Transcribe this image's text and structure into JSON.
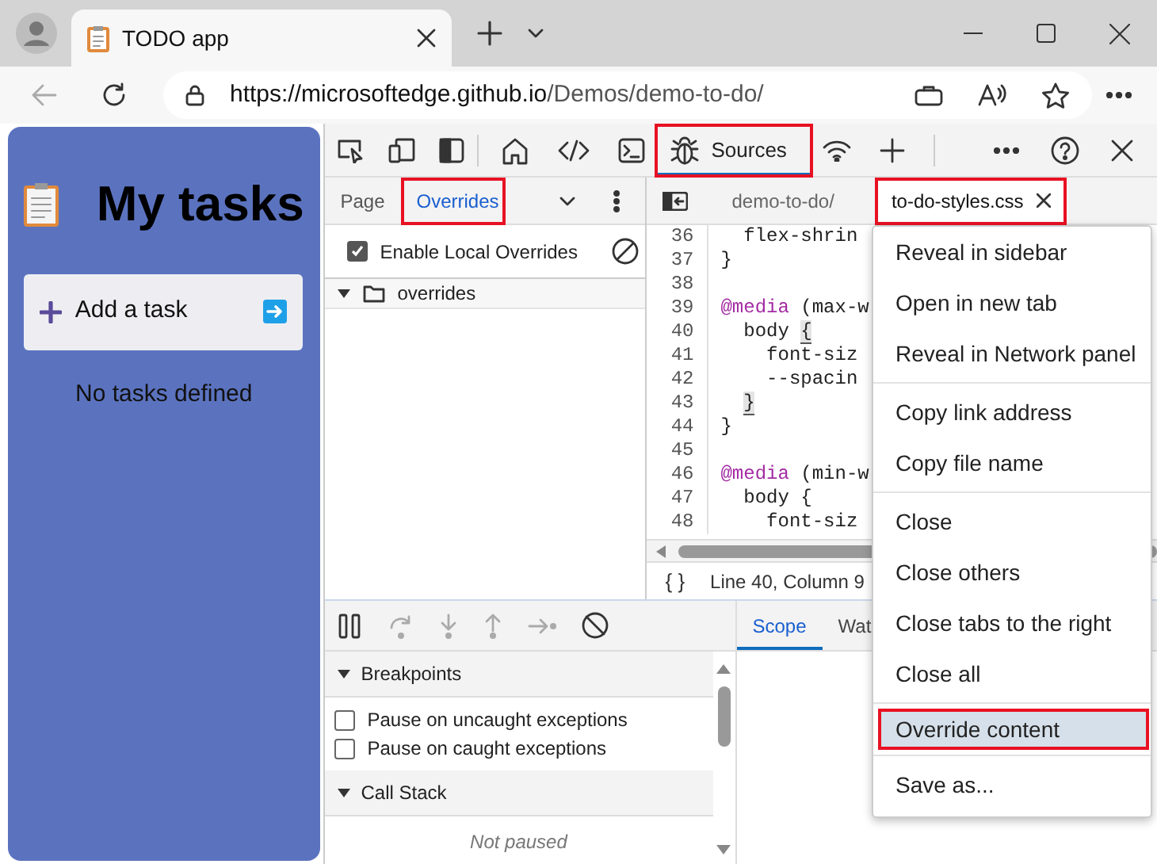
{
  "browser": {
    "tab": {
      "title": "TODO app",
      "selected": true
    },
    "url": {
      "host": "https://microsoftedge.github.io",
      "path": "/Demos/demo-to-do/"
    }
  },
  "app": {
    "title": "My tasks",
    "add_task": "Add a task",
    "empty_message": "No tasks defined"
  },
  "devtools": {
    "tool_tabs": [
      {
        "label": "Sources",
        "selected": true,
        "highlighted": true
      }
    ],
    "navigator": {
      "tabs": [
        {
          "label": "Page",
          "selected": false,
          "highlighted": false
        },
        {
          "label": "Overrides",
          "selected": true,
          "highlighted": true
        }
      ],
      "enable_overrides": {
        "label": "Enable Local Overrides",
        "checked": true
      },
      "tree": [
        {
          "label": "overrides",
          "expanded": true
        }
      ]
    },
    "editor": {
      "tabs": [
        {
          "label": "demo-to-do/",
          "selected": false,
          "highlighted": false,
          "closable": false
        },
        {
          "label": "to-do-styles.css",
          "selected": true,
          "highlighted": true,
          "closable": true
        }
      ],
      "lines": [
        {
          "number": "36",
          "segments": [
            {
              "kind": "plain",
              "text": "  flex-shrin"
            }
          ]
        },
        {
          "number": "37",
          "segments": [
            {
              "kind": "plain",
              "text": "}"
            }
          ]
        },
        {
          "number": "38"
        },
        {
          "number": "39",
          "segments": [
            {
              "kind": "keyword",
              "text": "@media"
            },
            {
              "kind": "plain",
              "text": " (max-w"
            }
          ]
        },
        {
          "number": "40",
          "segments": [
            {
              "kind": "plain",
              "text": "  body "
            },
            {
              "kind": "bracket",
              "text": "{"
            }
          ]
        },
        {
          "number": "41",
          "segments": [
            {
              "kind": "plain",
              "text": "    font-siz"
            }
          ]
        },
        {
          "number": "42",
          "segments": [
            {
              "kind": "plain",
              "text": "    --spacin"
            }
          ]
        },
        {
          "number": "43",
          "segments": [
            {
              "kind": "bracket",
              "text": "  }"
            }
          ]
        },
        {
          "number": "44",
          "segments": [
            {
              "kind": "plain",
              "text": "}"
            }
          ]
        },
        {
          "number": "45"
        },
        {
          "number": "46",
          "segments": [
            {
              "kind": "keyword",
              "text": "@media"
            },
            {
              "kind": "plain",
              "text": " (min-w"
            }
          ]
        },
        {
          "number": "47",
          "segments": [
            {
              "kind": "plain",
              "text": "  body {"
            }
          ]
        },
        {
          "number": "48",
          "segments": [
            {
              "kind": "plain",
              "text": "    font-siz"
            }
          ]
        }
      ],
      "format_glyph": "{ }",
      "status": "Line 40, Column 9"
    },
    "debugger": {
      "sections": [
        {
          "title": "Breakpoints",
          "expanded": true,
          "items": [
            {
              "label": "Pause on uncaught exceptions",
              "checked": false
            },
            {
              "label": "Pause on caught exceptions",
              "checked": false
            }
          ]
        },
        {
          "title": "Call Stack",
          "expanded": true,
          "message": "Not paused"
        }
      ],
      "sidebar_tabs": [
        {
          "label": "Scope",
          "selected": true
        },
        {
          "label": "Wat",
          "selected": false
        }
      ]
    }
  },
  "context_menu": {
    "groups": [
      {
        "items": [
          {
            "label": "Reveal in sidebar",
            "selected": false,
            "highlighted": false
          },
          {
            "label": "Open in new tab",
            "selected": false,
            "highlighted": false
          },
          {
            "label": "Reveal in Network panel",
            "selected": false,
            "highlighted": false
          }
        ]
      },
      {
        "items": [
          {
            "label": "Copy link address",
            "selected": false,
            "highlighted": false
          },
          {
            "label": "Copy file name",
            "selected": false,
            "highlighted": false
          }
        ]
      },
      {
        "items": [
          {
            "label": "Close",
            "selected": false,
            "highlighted": false
          },
          {
            "label": "Close others",
            "selected": false,
            "highlighted": false
          },
          {
            "label": "Close tabs to the right",
            "selected": false,
            "highlighted": false
          },
          {
            "label": "Close all",
            "selected": false,
            "highlighted": false
          }
        ]
      },
      {
        "items": [
          {
            "label": "Override content",
            "selected": true,
            "highlighted": true
          }
        ]
      },
      {
        "items": [
          {
            "label": "Save as...",
            "selected": false,
            "highlighted": false
          }
        ]
      }
    ]
  }
}
